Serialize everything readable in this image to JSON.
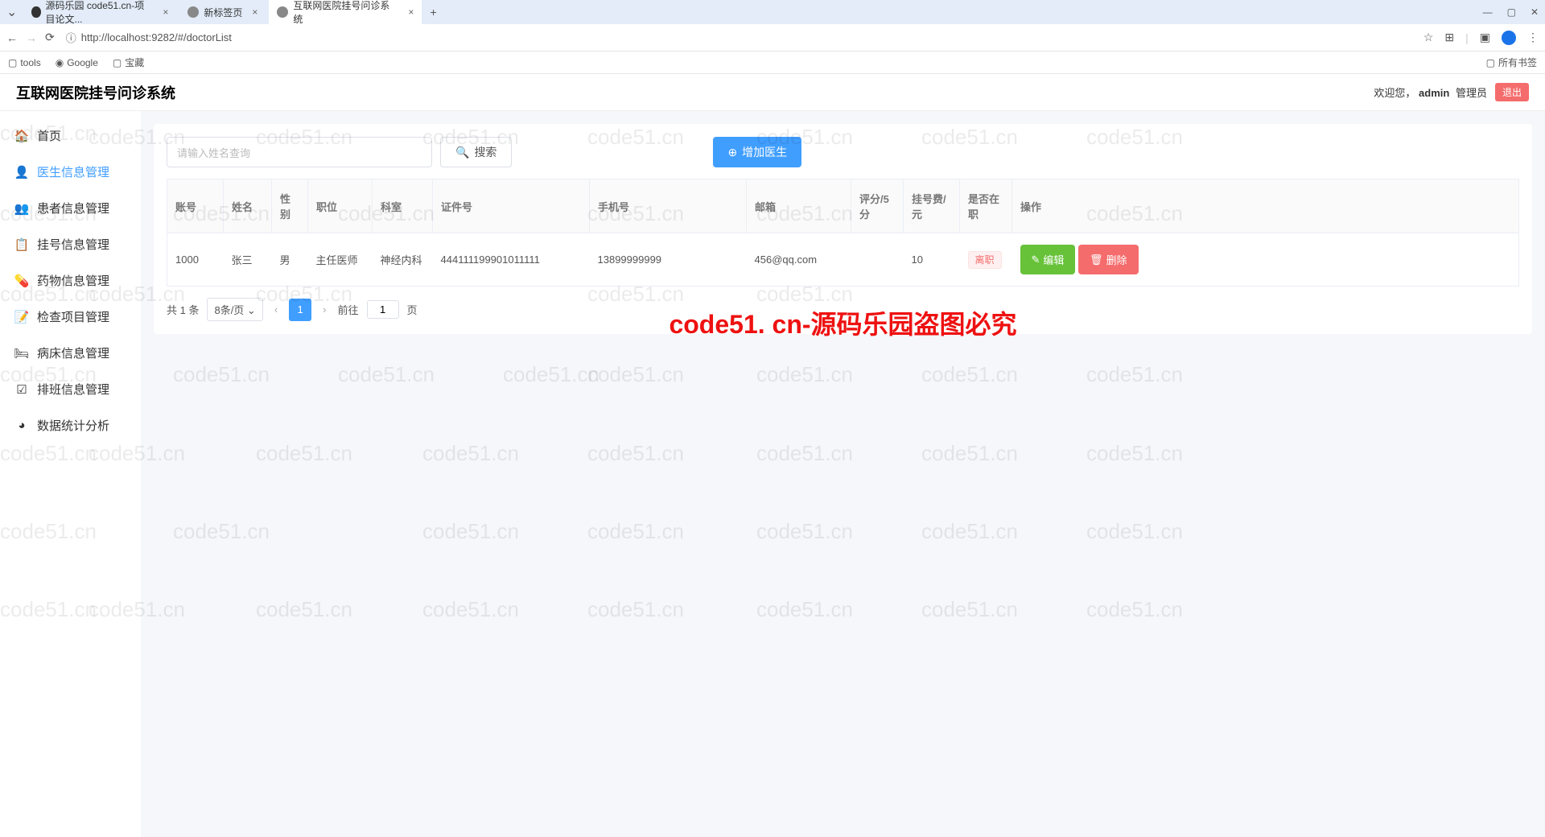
{
  "browser": {
    "tabs": [
      {
        "favicon": "y",
        "title": "源码乐园 code51.cn-项目论文...",
        "active": false
      },
      {
        "favicon": "globe",
        "title": "新标签页",
        "active": false
      },
      {
        "favicon": "globe",
        "title": "互联网医院挂号问诊系统",
        "active": true
      }
    ],
    "url": "http://localhost:9282/#/doctorList",
    "bookmarks": [
      "tools",
      "Google",
      "宝藏"
    ],
    "all_bookmarks": "所有书签"
  },
  "header": {
    "title": "互联网医院挂号问诊系统",
    "welcome_prefix": "欢迎您，",
    "username": "admin",
    "role": "管理员",
    "logout": "退出"
  },
  "sidebar": {
    "items": [
      {
        "icon": "home",
        "label": "首页"
      },
      {
        "icon": "user",
        "label": "医生信息管理",
        "active": true
      },
      {
        "icon": "users",
        "label": "患者信息管理"
      },
      {
        "icon": "list",
        "label": "挂号信息管理"
      },
      {
        "icon": "pill",
        "label": "药物信息管理"
      },
      {
        "icon": "check",
        "label": "检查项目管理"
      },
      {
        "icon": "bed",
        "label": "病床信息管理"
      },
      {
        "icon": "sched",
        "label": "排班信息管理"
      },
      {
        "icon": "chart",
        "label": "数据统计分析"
      }
    ]
  },
  "toolbar": {
    "search_placeholder": "请输入姓名查询",
    "search_label": "搜索",
    "add_label": "增加医生"
  },
  "table": {
    "headers": [
      "账号",
      "姓名",
      "性别",
      "职位",
      "科室",
      "证件号",
      "手机号",
      "邮箱",
      "评分/5分",
      "挂号费/元",
      "是否在职",
      "操作"
    ],
    "rows": [
      {
        "account": "1000",
        "name": "张三",
        "gender": "男",
        "position": "主任医师",
        "dept": "神经内科",
        "idno": "444111199901011111",
        "phone": "13899999999",
        "email": "456@qq.com",
        "score": "",
        "fee": "10",
        "status": "离职",
        "edit": "编辑",
        "delete": "删除"
      }
    ]
  },
  "pagination": {
    "total_label": "共 1 条",
    "page_size": "8条/页",
    "current": "1",
    "goto_prefix": "前往",
    "goto_value": "1",
    "goto_suffix": "页"
  },
  "watermark": {
    "bg": "code51.cn",
    "main": "code51. cn-源码乐园盗图必究"
  }
}
